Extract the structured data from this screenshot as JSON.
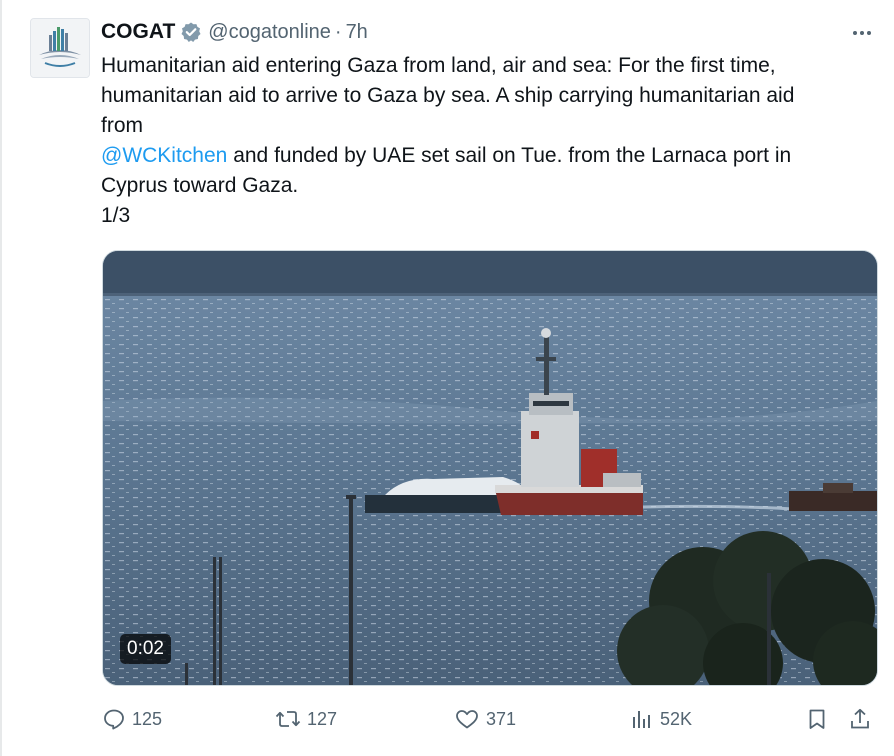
{
  "tweet": {
    "author_name": "COGAT",
    "handle": "@cogatonline",
    "separator": "·",
    "time": "7h",
    "text_lines": {
      "l1": "Humanitarian aid entering Gaza from land, air and sea:  For the first time,",
      "l2": "humanitarian aid to arrive to Gaza by sea. A ship carrying humanitarian aid",
      "l3": "from",
      "l4_mention": "@WCKitchen",
      "l4_rest": " and funded by UAE set sail on Tue. from the Larnaca port in",
      "l5": "Cyprus toward Gaza.",
      "l6": "1/3"
    },
    "video": {
      "duration": "0:02"
    }
  },
  "actions": {
    "replies": "125",
    "reposts": "127",
    "likes": "371",
    "views": "52K"
  },
  "icons": {
    "verified": "verified-badge-icon",
    "more": "more-options-icon",
    "reply": "reply-icon",
    "repost": "repost-icon",
    "like": "heart-icon",
    "views": "views-chart-icon",
    "bookmark": "bookmark-icon",
    "share": "share-icon"
  },
  "colors": {
    "text": "#0f1419",
    "secondary": "#536471",
    "link": "#1d9bf0",
    "verified_badge": "#829aab"
  }
}
